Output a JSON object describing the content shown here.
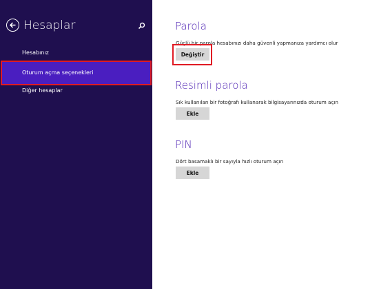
{
  "sidebar": {
    "title": "Hesaplar",
    "back_icon": "back-arrow-icon",
    "search_icon": "search-icon",
    "items": [
      {
        "label": "Hesabınız"
      },
      {
        "label": "Oturum açma seçenekleri",
        "selected": true
      },
      {
        "label": "Diğer hesaplar"
      }
    ]
  },
  "sections": [
    {
      "title": "Parola",
      "description": "Güçlü bir parola hesabınızı daha güvenli yapmanıza yardımcı olur",
      "button": "Değiştir"
    },
    {
      "title": "Resimli parola",
      "description": "Sık kullanılan bir fotoğrafı kullanarak bilgisayarınızda oturum açın",
      "button": "Ekle"
    },
    {
      "title": "PIN",
      "description": "Dört basamaklı bir sayıyla hızlı oturum açın",
      "button": "Ekle"
    }
  ],
  "colors": {
    "sidebar_bg": "#1f0f4f",
    "selected_bg": "#4a1ec0",
    "title_purple": "#4b1fb2",
    "highlight_red": "#e01b24",
    "button_gray": "#d6d6d6"
  }
}
